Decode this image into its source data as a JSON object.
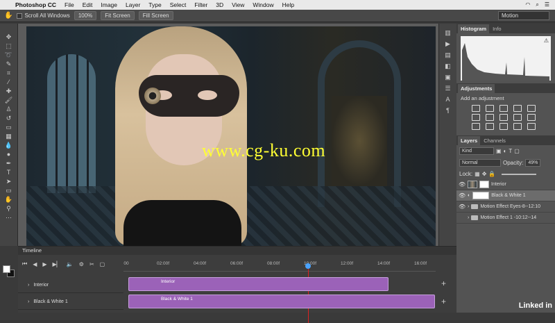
{
  "menubar": {
    "app": "Photoshop CC",
    "items": [
      "File",
      "Edit",
      "Image",
      "Layer",
      "Type",
      "Select",
      "Filter",
      "3D",
      "View",
      "Window",
      "Help"
    ]
  },
  "options": {
    "scroll_all": "Scroll All Windows",
    "zoom": "100%",
    "fit": "Fit Screen",
    "fill": "Fill Screen",
    "workspace": "Motion"
  },
  "watermark": "www.cg-ku.com",
  "histogram": {
    "tabs": [
      "Histogram",
      "Info"
    ]
  },
  "adjustments": {
    "tab": "Adjustments",
    "subtitle": "Add an adjustment"
  },
  "layers": {
    "tabs": [
      "Layers",
      "Channels"
    ],
    "kind": "Kind",
    "blend": "Normal",
    "opacity_label": "Opacity:",
    "opacity": "49%",
    "lock_label": "Lock:",
    "items": [
      {
        "name": "Interior"
      },
      {
        "name": "Black & White 1"
      },
      {
        "name": "Motion Effect Eyes-8--12:10"
      },
      {
        "name": "Motion Effect 1 -10:12--14"
      }
    ]
  },
  "timeline": {
    "title": "Timeline",
    "ticks": [
      "00",
      "02:00f",
      "04:00f",
      "06:00f",
      "08:00f",
      "10:00f",
      "12:00f",
      "14:00f",
      "16:00f"
    ],
    "tracks": [
      {
        "label": "Interior",
        "clip": "Interior"
      },
      {
        "label": "Black & White 1",
        "clip": "Black & White 1"
      }
    ]
  },
  "brand": "Linked in"
}
